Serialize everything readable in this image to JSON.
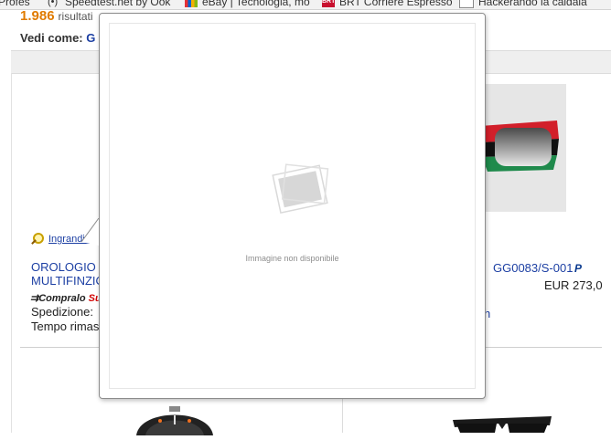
{
  "bookmarks": [
    {
      "label": "Profes",
      "icon": "folder-icon"
    },
    {
      "label": "Speedtest.net by Ook",
      "icon": "speedtest-icon"
    },
    {
      "label": "eBay | Tecnologia, mo",
      "icon": "ebay-icon"
    },
    {
      "label": "BRT Corriere Espresso",
      "icon": "brt-icon"
    },
    {
      "label": "Hackerando la caldaia",
      "icon": "page-icon"
    }
  ],
  "results": {
    "count": "1.986",
    "suffix": "risultati"
  },
  "view": {
    "label": "Vedi come:",
    "option": "G"
  },
  "listings": {
    "left": {
      "zoom_label": "Ingrandisci",
      "title_line1": "OROLOGIO",
      "title_line2": "MULTIFINZIO",
      "compralo": "Compralo",
      "compralo_highlight": "Subito",
      "shipping": "Spedizione:",
      "time_left": "Tempo rimasto"
    },
    "right": {
      "title": "GG0083/S-001",
      "paypal": "P",
      "price": "EUR 273,0",
      "extra": "h"
    }
  },
  "popup": {
    "message": "Immagine non disponibile",
    "placeholder_icon": "image-placeholder-icon"
  }
}
